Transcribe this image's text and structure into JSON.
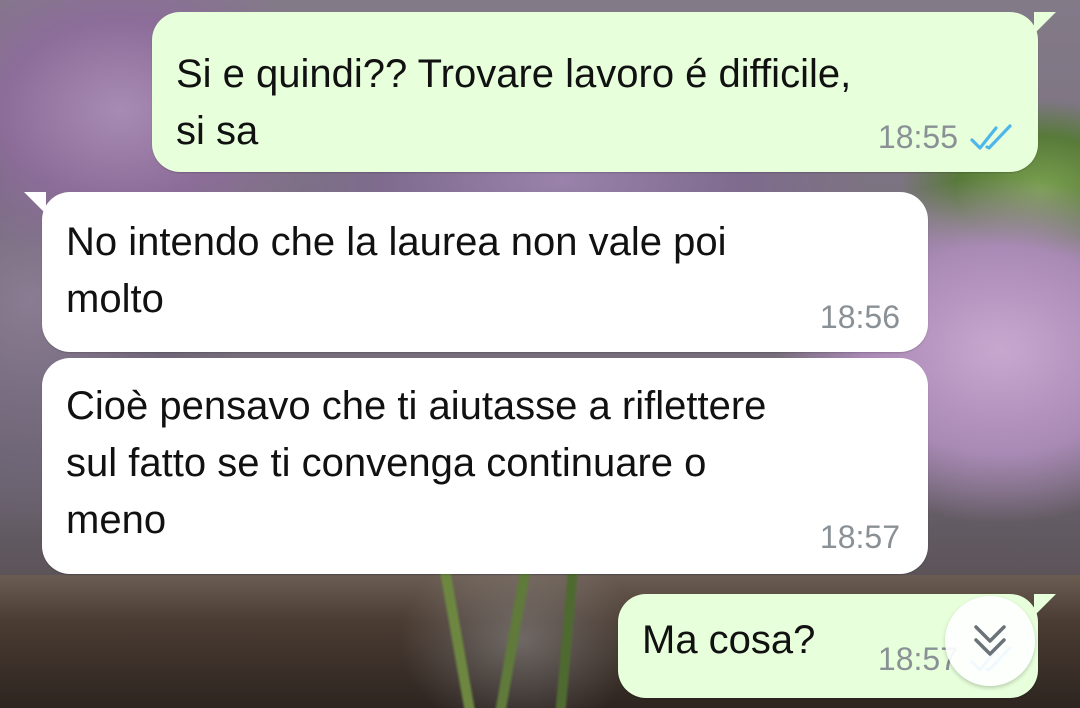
{
  "colors": {
    "outgoing_bubble": "#e7ffdb",
    "incoming_bubble": "#ffffff",
    "read_ticks": "#4fb6ec",
    "timestamp": "#8a9196"
  },
  "messages": [
    {
      "direction": "outgoing",
      "text": "Si e quindi?? Trovare lavoro é difficile,\nsi sa",
      "time": "18:55",
      "status_icon": "double-check-read-icon"
    },
    {
      "direction": "incoming",
      "text": "No intendo che la laurea non vale poi\nmolto",
      "time": "18:56"
    },
    {
      "direction": "incoming",
      "text": "Cioè pensavo che ti aiutasse a riflettere\nsul fatto se ti convenga continuare o\nmeno",
      "time": "18:57"
    },
    {
      "direction": "outgoing",
      "text": "Ma cosa?",
      "time": "18:57",
      "status_icon": "double-check-read-icon"
    }
  ],
  "scroll_button": {
    "icon": "double-chevron-down-icon"
  }
}
